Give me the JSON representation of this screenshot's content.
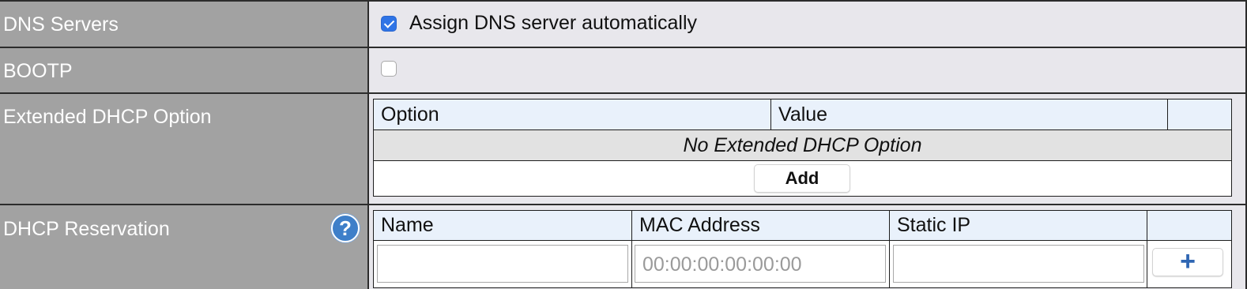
{
  "dns_servers": {
    "label": "DNS Servers",
    "checkbox_label": "Assign DNS server automatically",
    "checked": true
  },
  "bootp": {
    "label": "BOOTP",
    "checked": false
  },
  "extended_dhcp": {
    "label": "Extended DHCP Option",
    "columns": [
      "Option",
      "Value"
    ],
    "empty_message": "No Extended DHCP Option",
    "add_label": "Add"
  },
  "dhcp_reservation": {
    "label": "DHCP Reservation",
    "help_glyph": "?",
    "columns": [
      "Name",
      "MAC Address",
      "Static IP"
    ],
    "mac_placeholder": "00:00:00:00:00:00",
    "add_glyph": "+"
  },
  "colors": {
    "label_bg": "#a2a2a2",
    "value_bg": "#e8e7ec",
    "header_bg": "#e9f1fb",
    "accent": "#2f74e6"
  }
}
